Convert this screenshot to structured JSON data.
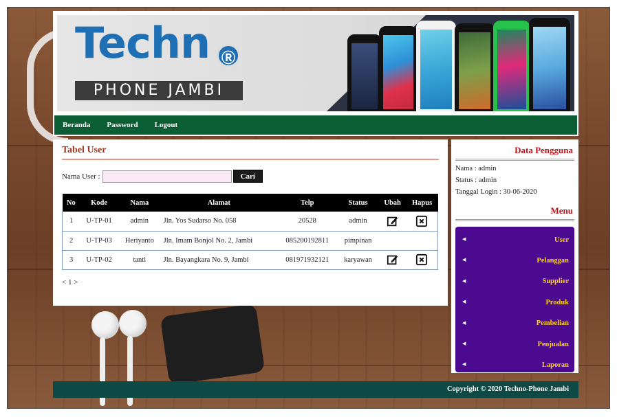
{
  "header": {
    "logo_title": "Techn",
    "logo_badge": "Ⓡ",
    "logo_subtitle": "PHONE JAMBI"
  },
  "nav": {
    "items": [
      "Beranda",
      "Password",
      "Logout"
    ]
  },
  "main": {
    "title": "Tabel User",
    "search": {
      "label": "Nama User :",
      "value": "",
      "placeholder": "",
      "button": "Cari"
    },
    "table": {
      "columns": [
        "No",
        "Kode",
        "Nama",
        "Alamat",
        "Telp",
        "Status",
        "Ubah",
        "Hapus"
      ],
      "rows": [
        {
          "no": "1",
          "kode": "U-TP-01",
          "nama": "admin",
          "alamat": "Jln. Yos Sudarso No. 058",
          "telp": "20528",
          "status": "admin",
          "edit": true,
          "delete": true
        },
        {
          "no": "2",
          "kode": "U-TP-03",
          "nama": "Heriyanto",
          "alamat": "Jln. Imam Bonjol No. 2, Jambi",
          "telp": "085200192811",
          "status": "pimpinan",
          "edit": false,
          "delete": false
        },
        {
          "no": "3",
          "kode": "U-TP-02",
          "nama": "tanti",
          "alamat": "Jln. Bayangkara No. 9, Jambi",
          "telp": "081971932121",
          "status": "karyawan",
          "edit": true,
          "delete": true
        }
      ]
    },
    "pager": "< 1 >"
  },
  "sidebar": {
    "user_title": "Data Pengguna",
    "info": {
      "nama": "Nama : admin",
      "status": "Status : admin",
      "login": "Tanggal Login : 30-06-2020"
    },
    "menu_title": "Menu",
    "menu": [
      "User",
      "Pelanggan",
      "Supplier",
      "Produk",
      "Pembelian",
      "Penjualan",
      "Laporan"
    ]
  },
  "footer": {
    "copyright": "Copyright © 2020 Techno-Phone Jambi"
  },
  "colors": {
    "nav_bg": "#0b5e34",
    "footer_bg": "#0d4a46",
    "menu_bg": "#4b0a8f",
    "menu_text": "#ffd400",
    "title_red": "#a0331e",
    "logo_blue": "#1f6fb5"
  },
  "icons": {
    "edit": "edit-icon",
    "delete": "delete-icon",
    "menu_arrow": "triangle-left-icon"
  }
}
